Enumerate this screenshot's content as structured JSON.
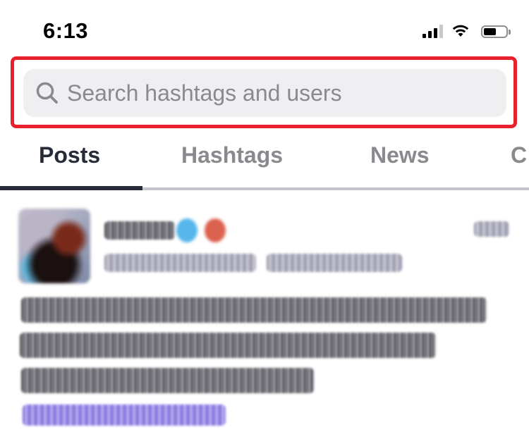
{
  "status_bar": {
    "time": "6:13",
    "battery_level": 0.55,
    "signal_bars_active": 3,
    "signal_bars_total": 4
  },
  "search": {
    "placeholder": "Search hashtags and users",
    "value": "",
    "highlight_color": "#e8222c"
  },
  "tabs": [
    {
      "label": "Posts",
      "active": true
    },
    {
      "label": "Hashtags",
      "active": false
    },
    {
      "label": "News",
      "active": false
    },
    {
      "label": "C",
      "active": false
    }
  ],
  "colors": {
    "active_tab": "#272a37",
    "inactive_tab": "#8a8a8e",
    "search_bg": "#efeff1"
  }
}
